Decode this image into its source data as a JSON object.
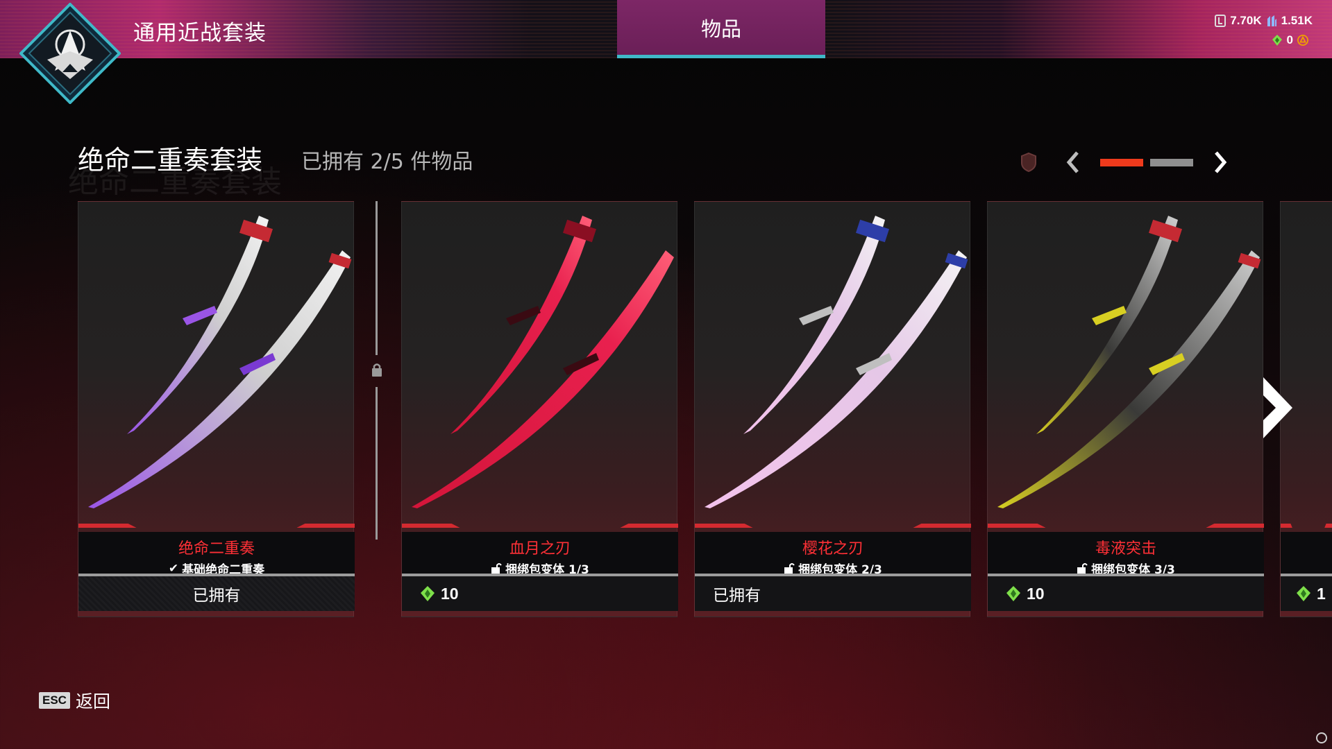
{
  "header": {
    "set_title": "通用近战套装",
    "tab_label": "物品",
    "currency": {
      "legend_tokens": "7.70K",
      "crafting_metals": "1.51K",
      "exotic_shards": "0",
      "apex_coins": "",
      "apex_coins_color": "#e0203a"
    }
  },
  "collection": {
    "title": "绝命二重奏套装",
    "owned_text": "已拥有 2/5 件物品",
    "pager": {
      "pages": 2,
      "current": 1,
      "active_color": "#ee3a1c",
      "inactive_color": "#8f8f8f"
    }
  },
  "cards": [
    {
      "name": "绝命二重奏",
      "subtitle": "基础绝命二重奏",
      "subtitle_icon": "checkmark-icon",
      "status": "已拥有",
      "price": null,
      "blade_color": "#9a55e6"
    },
    {
      "name": "血月之刃",
      "subtitle": "捆绑包变体 1/3",
      "subtitle_icon": "unlock-icon",
      "status": null,
      "price": "10",
      "blade_color": "#d4153a"
    },
    {
      "name": "樱花之刃",
      "subtitle": "捆绑包变体 2/3",
      "subtitle_icon": "unlock-icon",
      "status": "已拥有",
      "price": null,
      "blade_color": "#f3c2ec"
    },
    {
      "name": "毒液突击",
      "subtitle": "捆绑包变体 3/3",
      "subtitle_icon": "unlock-icon",
      "status": null,
      "price": "10",
      "blade_color": "#d8cf22"
    },
    {
      "name": "",
      "subtitle": "",
      "status": null,
      "price": "1",
      "blade_color": "#a08236"
    }
  ],
  "footer": {
    "esc_key": "ESC",
    "back_label": "返回"
  },
  "colors": {
    "accent_red": "#d42a30",
    "item_name_red": "#ff3036",
    "tab_bg": "#7d2766",
    "tab_underline": "#3fb9c8",
    "exotic_green": "#7ee04a"
  }
}
